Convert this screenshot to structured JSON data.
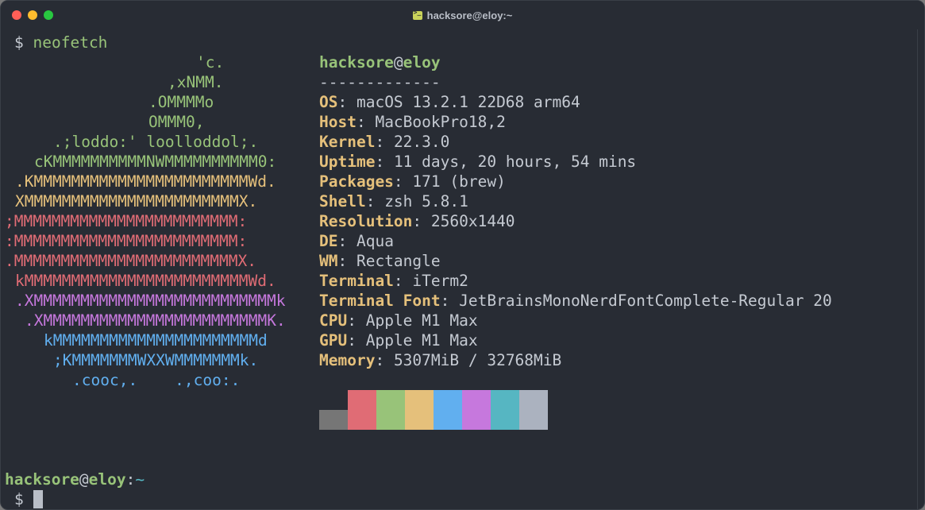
{
  "window": {
    "title": "hacksore@eloy:~",
    "title_icon": "terminal-icon"
  },
  "prompt": {
    "symbol": "$",
    "command": "neofetch"
  },
  "logo": [
    {
      "text": "'c.",
      "color": "#98c379"
    },
    {
      "text": ",xNMM.",
      "color": "#98c379"
    },
    {
      "text": ".OMMMMo",
      "color": "#98c379"
    },
    {
      "text": "OMMM0,",
      "color": "#98c379"
    },
    {
      "text": ".;loddo:' loolloddol;.",
      "color": "#98c379"
    },
    {
      "text": "cKMMMMMMMMMMNWMMMMMMMMMM0:",
      "color": "#98c379"
    },
    {
      "text": ".KMMMMMMMMMMMMMMMMMMMMMMMWd.",
      "color": "#e5c07b"
    },
    {
      "text": "XMMMMMMMMMMMMMMMMMMMMMMMX.",
      "color": "#e5c07b"
    },
    {
      "text": ";MMMMMMMMMMMMMMMMMMMMMMMM:",
      "color": "#e06c75"
    },
    {
      "text": ":MMMMMMMMMMMMMMMMMMMMMMMM:",
      "color": "#e06c75"
    },
    {
      "text": ".MMMMMMMMMMMMMMMMMMMMMMMMX.",
      "color": "#e06c75"
    },
    {
      "text": "kMMMMMMMMMMMMMMMMMMMMMMMMWd.",
      "color": "#e06c75"
    },
    {
      "text": ".XMMMMMMMMMMMMMMMMMMMMMMMMMMk",
      "color": "#c678dd"
    },
    {
      "text": ".XMMMMMMMMMMMMMMMMMMMMMMMMK.",
      "color": "#c678dd"
    },
    {
      "text": "kMMMMMMMMMMMMMMMMMMMMMMd",
      "color": "#61afef"
    },
    {
      "text": ";KMMMMMMMWXXWMMMMMMMk.",
      "color": "#61afef"
    },
    {
      "text": ".cooc,.    .,coo:.",
      "color": "#61afef"
    }
  ],
  "info": {
    "user": "hacksore",
    "at": "@",
    "host": "eloy",
    "separator": "-------------",
    "rows": [
      {
        "key": "OS",
        "value": "macOS 13.2.1 22D68 arm64"
      },
      {
        "key": "Host",
        "value": "MacBookPro18,2"
      },
      {
        "key": "Kernel",
        "value": "22.3.0"
      },
      {
        "key": "Uptime",
        "value": "11 days, 20 hours, 54 mins"
      },
      {
        "key": "Packages",
        "value": "171 (brew)"
      },
      {
        "key": "Shell",
        "value": "zsh 5.8.1"
      },
      {
        "key": "Resolution",
        "value": "2560x1440"
      },
      {
        "key": "DE",
        "value": "Aqua"
      },
      {
        "key": "WM",
        "value": "Rectangle"
      },
      {
        "key": "Terminal",
        "value": "iTerm2"
      },
      {
        "key": "Terminal Font",
        "value": "JetBrainsMonoNerdFontComplete-Regular 20"
      },
      {
        "key": "CPU",
        "value": "Apple M1 Max"
      },
      {
        "key": "GPU",
        "value": "Apple M1 Max"
      },
      {
        "key": "Memory",
        "value": "5307MiB / 32768MiB"
      }
    ]
  },
  "palette": [
    "#767676",
    "#e06c75",
    "#98c379",
    "#e5c07b",
    "#61afef",
    "#c678dd",
    "#56b6c2",
    "#abb2bf"
  ],
  "final_prompt": {
    "user": "hacksore",
    "at": "@",
    "host": "eloy",
    "colon": ":",
    "path": "~",
    "symbol": "$"
  }
}
